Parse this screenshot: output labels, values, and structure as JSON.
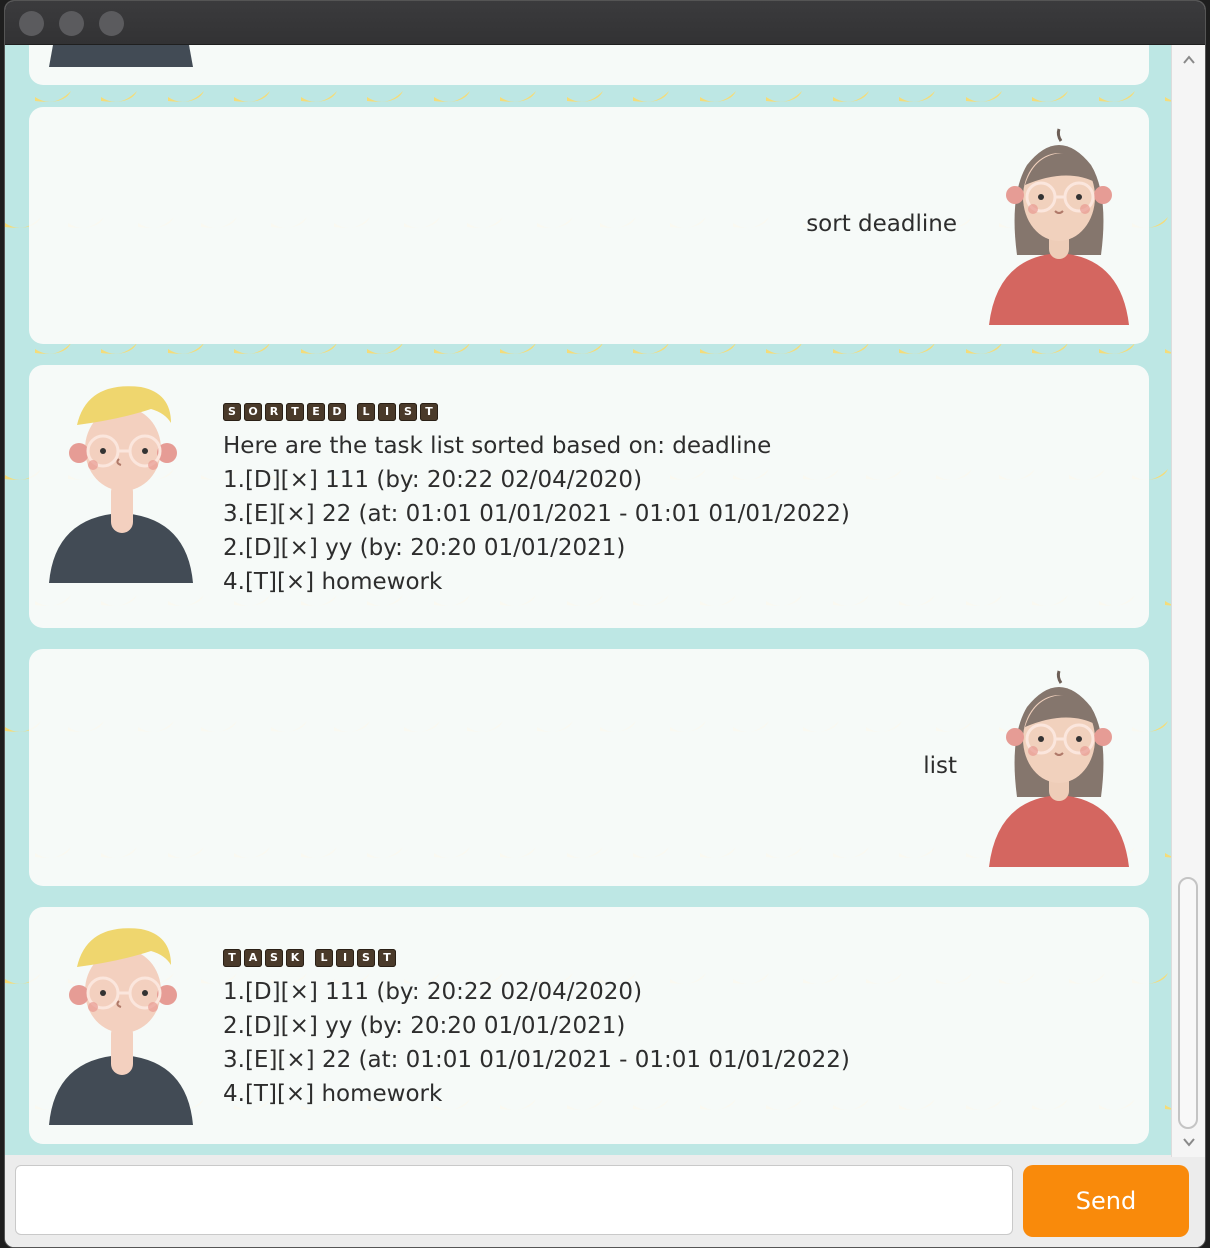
{
  "window": {
    "title": ""
  },
  "messages": [
    {
      "sender": "user",
      "lines": [
        "sort deadline"
      ]
    },
    {
      "sender": "bot",
      "tag": [
        "S",
        "O",
        "R",
        "T",
        "E",
        "D",
        " ",
        "L",
        "I",
        "S",
        "T"
      ],
      "lines": [
        "Here are the task list sorted based on: deadline",
        "1.[D][×] 111 (by: 20:22 02/04/2020)",
        "3.[E][×] 22 (at: 01:01 01/01/2021 - 01:01 01/01/2022)",
        "2.[D][×] yy (by: 20:20 01/01/2021)",
        "4.[T][×] homework"
      ]
    },
    {
      "sender": "user",
      "lines": [
        "list"
      ]
    },
    {
      "sender": "bot",
      "tag": [
        "T",
        "A",
        "S",
        "K",
        " ",
        "L",
        "I",
        "S",
        "T"
      ],
      "lines": [
        "1.[D][×] 111 (by: 20:22 02/04/2020)",
        "2.[D][×] yy (by: 20:20 01/01/2021)",
        "3.[E][×] 22 (at: 01:01 01/01/2021 - 01:01 01/01/2022)",
        "4.[T][×] homework"
      ]
    }
  ],
  "input": {
    "value": "",
    "placeholder": ""
  },
  "send": {
    "label": "Send"
  },
  "colors": {
    "accent": "#f98a0b",
    "chat_bg": "#bde7e4",
    "banana": "#f4dc7a"
  }
}
